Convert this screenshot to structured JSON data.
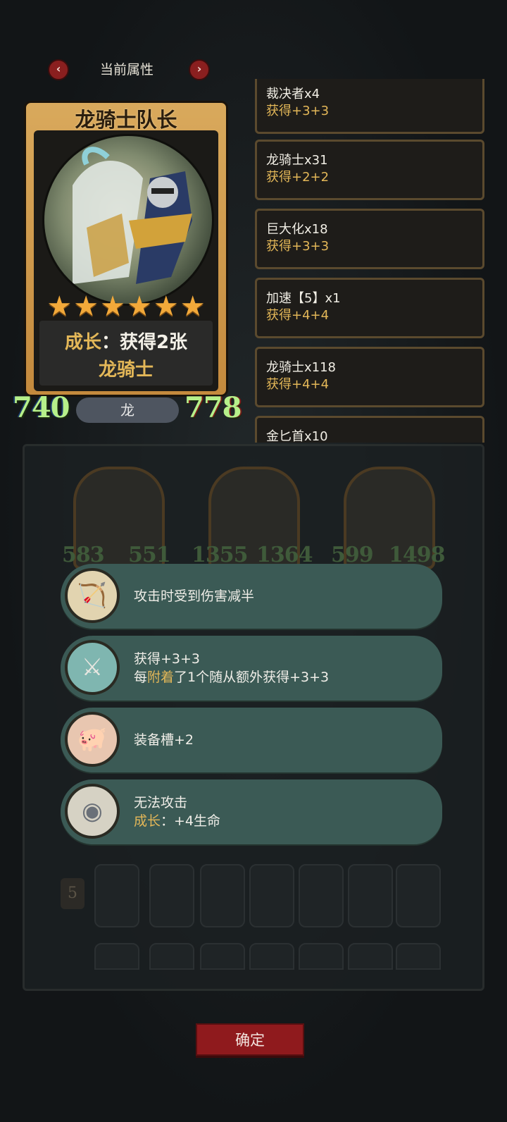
{
  "header": {
    "title": "当前属性",
    "prev_icon": "chevron-left-icon",
    "next_icon": "chevron-right-icon",
    "prev_glyph": "‹",
    "next_glyph": "›"
  },
  "hero": {
    "name": "龙骑士队长",
    "stars": 6,
    "growth_prefix": "成长",
    "growth_colon": "：",
    "growth_rest": "获得2张",
    "growth_line2": "龙骑士",
    "attack": "740",
    "health": "778",
    "tribe": "龙"
  },
  "attribute_list": [
    {
      "name": "裁决者x4",
      "value": "获得+3+3"
    },
    {
      "name": "龙骑士x31",
      "value": "获得+2+2"
    },
    {
      "name": "巨大化x18",
      "value": "获得+3+3"
    },
    {
      "name": "加速【5】x1",
      "value": "获得+4+4"
    },
    {
      "name": "龙骑士x118",
      "value": "获得+4+4"
    },
    {
      "name": "金匕首x10",
      "value": ""
    }
  ],
  "board_units": [
    {
      "attack": "583",
      "health": "551"
    },
    {
      "attack": "1355",
      "health": "1364"
    },
    {
      "attack": "599",
      "health": "1498"
    }
  ],
  "hand_level": "5",
  "effects": [
    {
      "icon": "crossbow-icon",
      "glyph": "🏹",
      "line1": "攻击时受到伤害减半"
    },
    {
      "icon": "warrior-icon",
      "glyph": "⚔",
      "line1": "获得+3+3",
      "line2_a": "每",
      "line2_hl": "附着",
      "line2_b": "了1个随从额外获得+3+3"
    },
    {
      "icon": "pig-icon",
      "glyph": "🐖",
      "line1": "装备槽+2"
    },
    {
      "icon": "coin-icon",
      "glyph": "◉",
      "line1": "无法攻击",
      "line2_hl": "成长",
      "line2_b": "：+4生命"
    }
  ],
  "confirm_label": "确定",
  "colors": {
    "accent_gold": "#e3b758",
    "stat_green": "#b6f08a",
    "panel_teal": "#3b5a55",
    "button_red": "#8f1a1d"
  }
}
